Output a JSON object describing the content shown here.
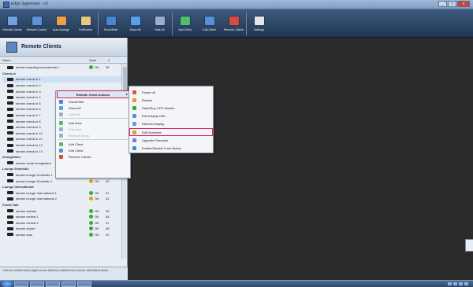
{
  "window": {
    "title": "Edge Supervisor - v3"
  },
  "window_buttons": {
    "minimize": "_",
    "maximize": "□",
    "close": "x"
  },
  "toolbar": [
    {
      "label": "Remote Clients",
      "icon": "monitor-icon",
      "color": "#6fa0e0"
    },
    {
      "label": "Remote Control",
      "icon": "monitor-icon",
      "color": "#5f93d8"
    },
    {
      "label": "Auto Arrange",
      "icon": "grid-icon",
      "color": "#f0a040"
    },
    {
      "label": "FullScreen",
      "icon": "fullscreen-icon",
      "color": "#e8c878"
    },
    {
      "label": "Show/Hide",
      "icon": "eye-icon",
      "color": "#4a86d0"
    },
    {
      "label": "Show All",
      "icon": "windows-icon",
      "color": "#5aa0e6"
    },
    {
      "label": "Hide All",
      "icon": "monitor-icon",
      "color": "#9ab0c8"
    },
    {
      "label": "Add Client",
      "icon": "add-user-icon",
      "color": "#4fbf6a"
    },
    {
      "label": "Edit Client",
      "icon": "edit-icon",
      "color": "#5a8fd8"
    },
    {
      "label": "Remove Clients",
      "icon": "remove-icon",
      "color": "#d84a3a"
    },
    {
      "label": "Settings",
      "icon": "gear-icon",
      "color": "#e6e6e6"
    }
  ],
  "panel": {
    "title": "Remote Clients",
    "columns": {
      "name": "Name",
      "state": "State",
      "num": "#"
    },
    "footer": "Use the context menu (right mouse button) to add/remove remote client/client areas."
  },
  "tree": [
    {
      "type": "item",
      "name": "stream boarding International 1",
      "state": "OK",
      "num": "36",
      "dot": "#3aa83a"
    },
    {
      "type": "group",
      "name": "Check-In"
    },
    {
      "type": "item",
      "name": "stream check-in 1",
      "state": "",
      "num": "",
      "dot": "",
      "selected": true
    },
    {
      "type": "item",
      "name": "stream check-in 2",
      "state": "",
      "num": "",
      "dot": ""
    },
    {
      "type": "item",
      "name": "stream check-in 3",
      "state": "",
      "num": "",
      "dot": ""
    },
    {
      "type": "item",
      "name": "stream check-in 4",
      "state": "",
      "num": "",
      "dot": ""
    },
    {
      "type": "item",
      "name": "stream check-in 5",
      "state": "",
      "num": "",
      "dot": ""
    },
    {
      "type": "item",
      "name": "stream check-in 6",
      "state": "",
      "num": "",
      "dot": ""
    },
    {
      "type": "item",
      "name": "stream check-in 7",
      "state": "",
      "num": "",
      "dot": ""
    },
    {
      "type": "item",
      "name": "stream check-in 8",
      "state": "",
      "num": "",
      "dot": ""
    },
    {
      "type": "item",
      "name": "stream check-in 9",
      "state": "",
      "num": "",
      "dot": ""
    },
    {
      "type": "item",
      "name": "stream check-in 10",
      "state": "",
      "num": "",
      "dot": ""
    },
    {
      "type": "item",
      "name": "stream check-in 11",
      "state": "",
      "num": "",
      "dot": ""
    },
    {
      "type": "item",
      "name": "stream check-in 12",
      "state": "",
      "num": "",
      "dot": ""
    },
    {
      "type": "item",
      "name": "stream check-in 13",
      "state": "",
      "num": "",
      "dot": ""
    },
    {
      "type": "group",
      "name": "Immigration"
    },
    {
      "type": "item",
      "name": "stream south immigration",
      "state": "OK",
      "num": "38",
      "dot": "#3aa83a"
    },
    {
      "type": "group",
      "name": "Lounge Domestic"
    },
    {
      "type": "item",
      "name": "stream lounge Domestic 1",
      "state": "OK",
      "num": "39",
      "dot": "#3aa83a"
    },
    {
      "type": "item",
      "name": "stream lounge Domestic 2",
      "state": "OK",
      "num": "40",
      "dot": "#e0a020"
    },
    {
      "type": "group",
      "name": "Lounge International"
    },
    {
      "type": "item",
      "name": "stream lounge International 1",
      "state": "OK",
      "num": "41",
      "dot": "#3aa83a"
    },
    {
      "type": "item",
      "name": "stream lounge International 2",
      "state": "OK",
      "num": "42",
      "dot": "#e0a020"
    },
    {
      "type": "group",
      "name": "Public Hall"
    },
    {
      "type": "item",
      "name": "stream arrivals",
      "state": "OK",
      "num": "45",
      "dot": "#3aa83a"
    },
    {
      "type": "item",
      "name": "stream central 1",
      "state": "OK",
      "num": "46",
      "dot": "#3aa83a"
    },
    {
      "type": "item",
      "name": "stream central 2",
      "state": "OK",
      "num": "47",
      "dot": "#3aa83a"
    },
    {
      "type": "item",
      "name": "stream depart",
      "state": "OK",
      "num": "48",
      "dot": "#3aa83a"
    },
    {
      "type": "item",
      "name": "stream east",
      "state": "OK",
      "num": "49",
      "dot": "#3aa83a"
    }
  ],
  "context_menu": {
    "header": "Remote Client Actions",
    "submenu_arrow": "▸",
    "items": [
      {
        "label": "Show/Hide",
        "icon": "eye-icon",
        "color": "#4a86d0",
        "disabled": false
      },
      {
        "label": "Show All",
        "icon": "windows-icon",
        "color": "#5aa0e6",
        "disabled": false
      },
      {
        "label": "Hide All",
        "icon": "monitor-icon",
        "color": "#9ab0c8",
        "disabled": true
      },
      {
        "sep": true
      },
      {
        "label": "Add Area",
        "icon": "add-area-icon",
        "color": "#4fbf6a",
        "disabled": false
      },
      {
        "label": "Edit Area",
        "icon": "edit-area-icon",
        "color": "#9ab0c8",
        "disabled": true
      },
      {
        "label": "Remove Areas",
        "icon": "remove-area-icon",
        "color": "#9ab0c8",
        "disabled": true
      },
      {
        "sep": true
      },
      {
        "label": "Add Client",
        "icon": "add-user-icon",
        "color": "#4fbf6a",
        "disabled": false
      },
      {
        "label": "Edit Client",
        "icon": "edit-icon",
        "color": "#5a8fd8",
        "disabled": false
      },
      {
        "label": "Remove Clients",
        "icon": "remove-icon",
        "color": "#d84a3a",
        "disabled": false
      }
    ]
  },
  "submenu": {
    "items": [
      {
        "label": "Power off",
        "color": "#e05030"
      },
      {
        "label": "Restart",
        "color": "#f09030"
      },
      {
        "label": "Start/Stop CPU Monitor",
        "color": "#3aa83a"
      },
      {
        "label": "Edit Display URL",
        "color": "#5a8fd8"
      },
      {
        "label": "Refresh Display",
        "color": "#5aa0e6"
      },
      {
        "label": "Edit Schedule",
        "color": "#e0a020",
        "highlighted": true
      },
      {
        "label": "Upgrade Firmware",
        "color": "#7a7ad8"
      },
      {
        "label": "Enable/Disable Front Button",
        "color": "#4a86d0"
      }
    ]
  },
  "highlight_color": "#d81b5d"
}
